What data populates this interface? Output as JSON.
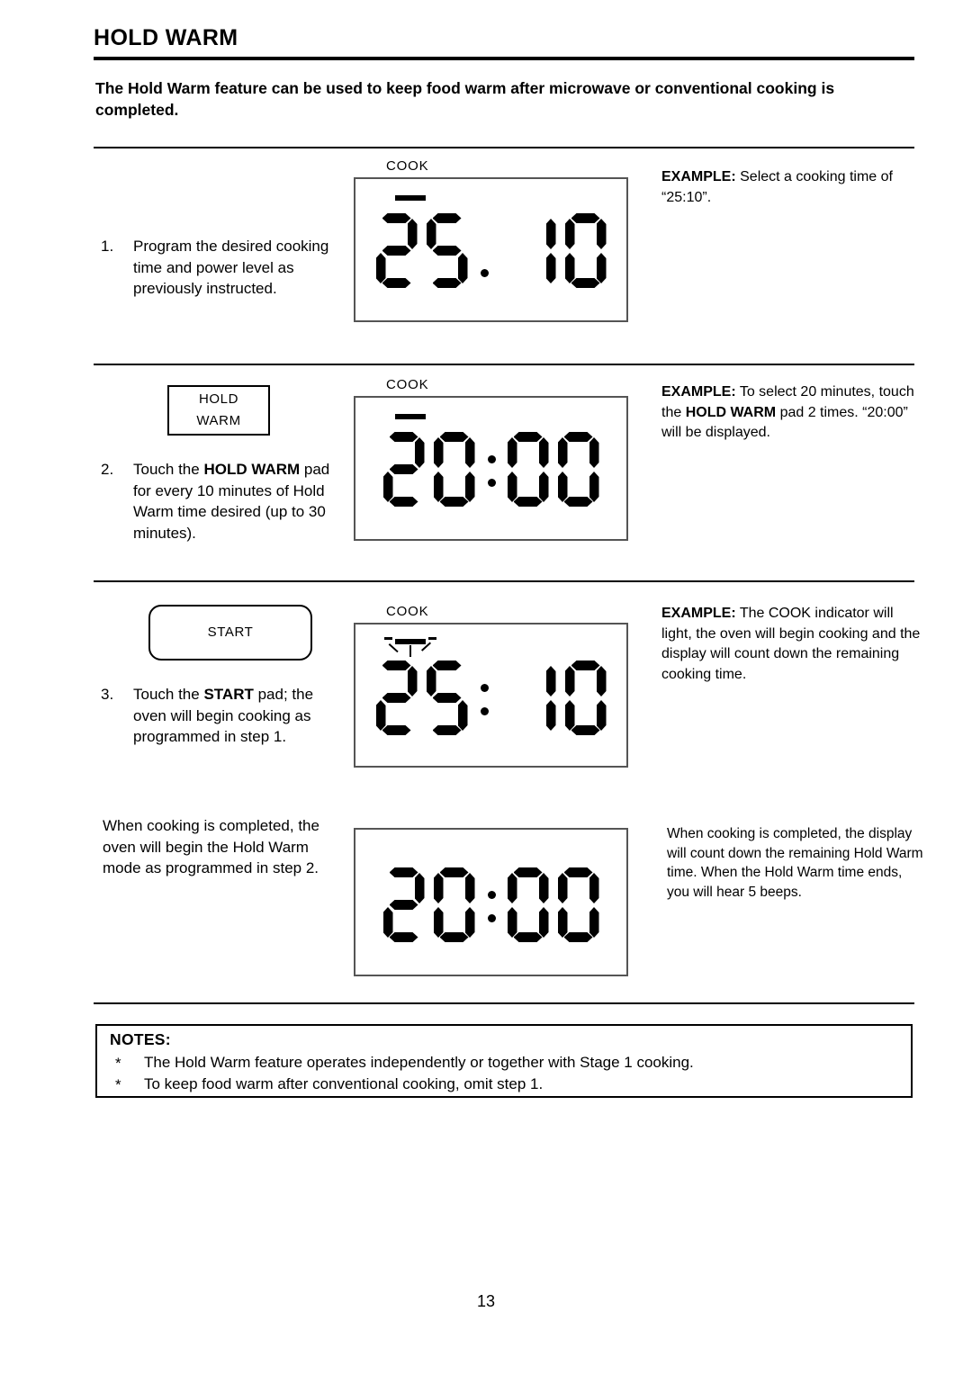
{
  "document": {
    "title": "HOLD WARM",
    "intro": "The Hold Warm feature can be used to keep food warm after microwave or conventional cooking is completed.",
    "page_number": "13"
  },
  "steps": [
    {
      "number": "1.",
      "text": "Program the desired cooking time and power level as previously instructed.",
      "display": {
        "label": "COOK",
        "indicator": "unlit",
        "time": "25.10",
        "separator": "period",
        "digits": [
          "2",
          "5",
          "1",
          "0"
        ]
      },
      "example": {
        "lead": "EXAMPLE:",
        "text": " Select a cooking time of “25:10”."
      }
    },
    {
      "number": "2.",
      "pad": {
        "line1": "HOLD",
        "line2": "WARM",
        "shape": "rectangle"
      },
      "text_parts": [
        "Touch the ",
        "HOLD WARM",
        " pad for every 10 minutes of Hold Warm time desired (up to 30 minutes)."
      ],
      "display": {
        "label": "COOK",
        "indicator": "unlit",
        "time": "20:00",
        "separator": "colon",
        "digits": [
          "2",
          "0",
          "0",
          "0"
        ]
      },
      "example": {
        "lead": "EXAMPLE:",
        "parts": [
          " To select 20 minutes, touch the ",
          "HOLD WARM",
          " pad 2 times. “20:00” will be displayed."
        ]
      }
    },
    {
      "number": "3.",
      "pad": {
        "line1": "START",
        "line2": "",
        "shape": "rounded"
      },
      "text_parts": [
        "Touch the ",
        "START",
        " pad; the oven will begin cooking as programmed in step 1."
      ],
      "display": {
        "label": "COOK",
        "indicator": "lit",
        "time": "25:10",
        "separator": "colon",
        "digits": [
          "2",
          "5",
          "1",
          "0"
        ]
      },
      "example": {
        "lead": "EXAMPLE:",
        "text": " The COOK indicator will light, the oven will begin cooking and the display will count down the remaining cooking time."
      }
    },
    {
      "number": "",
      "text": "When cooking is completed, the oven will begin the Hold Warm mode as programmed in step 2.",
      "display": {
        "label": "",
        "indicator": "none",
        "time": "20:00",
        "separator": "colon",
        "digits": [
          "2",
          "0",
          "0",
          "0"
        ]
      },
      "example": {
        "lead": "",
        "text": "When cooking is completed, the display will count down the remaining Hold Warm time. When the Hold Warm time ends, you will hear 5 beeps."
      }
    }
  ],
  "notes": {
    "title": "NOTES:",
    "bullet": "*",
    "items": [
      "The Hold Warm feature operates independently or together with Stage 1 cooking.",
      "To keep food warm after conventional cooking, omit step 1."
    ]
  }
}
